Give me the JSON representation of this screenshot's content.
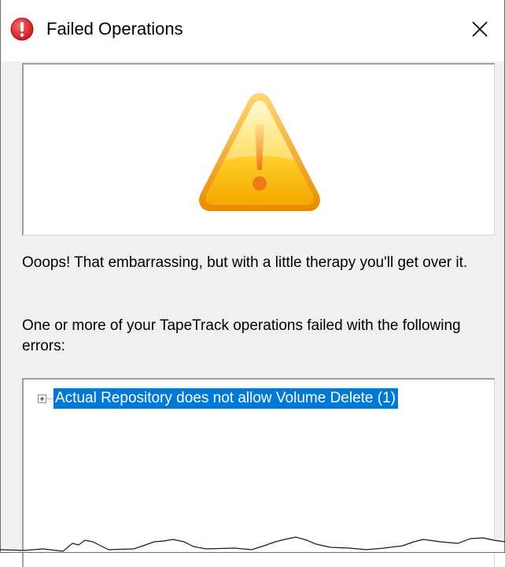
{
  "window": {
    "title": "Failed Operations",
    "title_icon": "error-icon",
    "close_icon": "close-icon"
  },
  "image_panel": {
    "icon": "warning-triangle-icon"
  },
  "messages": {
    "line1": "Ooops! That embarrassing, but with a little therapy you'll get over it.",
    "line2": "One or more of your TapeTrack operations failed with the following errors:"
  },
  "error_tree": {
    "items": [
      {
        "label": "Actual Repository does not allow Volume Delete (1)",
        "expander": "plus-expander-icon",
        "selected": true
      }
    ]
  },
  "colors": {
    "selection": "#0078d7",
    "dialog_background": "#f0f0f0",
    "error_icon": "#d9242b",
    "warning_icon": "#f7c21d"
  }
}
